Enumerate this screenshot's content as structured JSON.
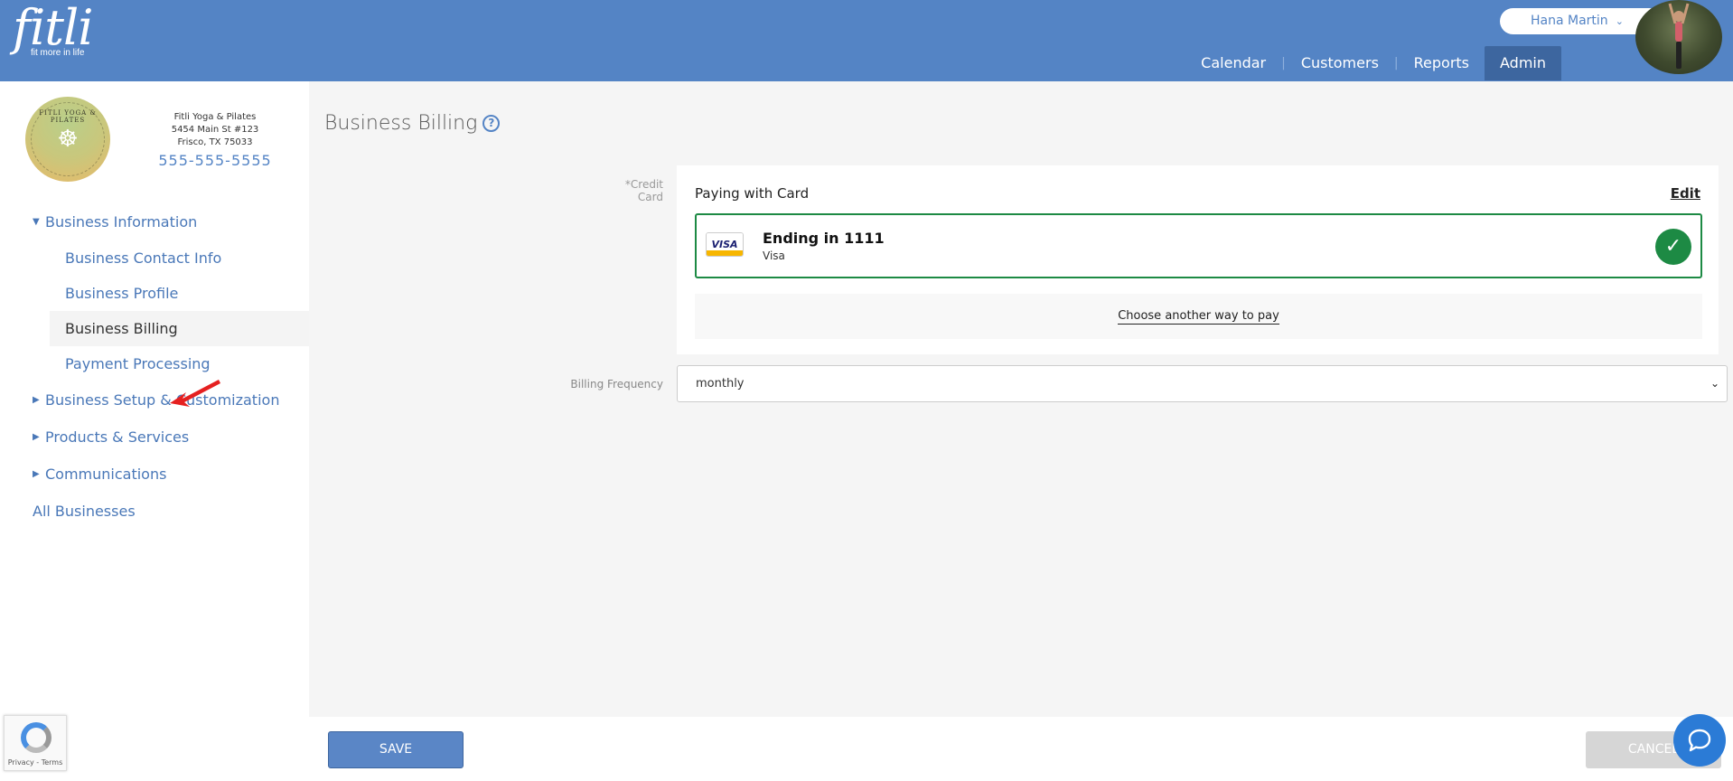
{
  "header": {
    "logo_word": "fitli",
    "logo_tagline": "fit more in life",
    "user_name": "Hana Martin",
    "nav": [
      {
        "label": "Calendar"
      },
      {
        "label": "Customers"
      },
      {
        "label": "Reports"
      },
      {
        "label": "Admin",
        "active": true
      }
    ]
  },
  "sidebar": {
    "business_name": "Fitli Yoga & Pilates",
    "address_line1": "5454 Main St #123",
    "address_line2": "Frisco, TX 75033",
    "phone": "555-555-5555",
    "logo_text": "FITLI YOGA & PILATES",
    "menu": {
      "business_information": "Business Information",
      "business_contact_info": "Business Contact Info",
      "business_profile": "Business Profile",
      "business_billing": "Business Billing",
      "payment_processing": "Payment Processing",
      "business_setup": "Business Setup & Customization",
      "products_services": "Products & Services",
      "communications": "Communications",
      "all_businesses": "All Businesses"
    }
  },
  "main": {
    "title": "Business Billing",
    "help_icon": "?",
    "credit_card_label": "*Credit Card",
    "paying_with_card": "Paying with Card",
    "edit": "Edit",
    "card_badge": "VISA",
    "card_ending": "Ending in 1111",
    "card_brand": "Visa",
    "choose_another": "Choose another way to pay",
    "billing_frequency_label": "Billing Frequency",
    "billing_frequency_value": "monthly"
  },
  "footer": {
    "save": "SAVE",
    "cancel": "CANCEL"
  },
  "recaptcha": {
    "links": "Privacy - Terms"
  },
  "colors": {
    "header_blue": "#5484c5",
    "admin_active": "#3d669f",
    "selected_green": "#1d8a44",
    "chat_blue": "#2b7bd6"
  }
}
